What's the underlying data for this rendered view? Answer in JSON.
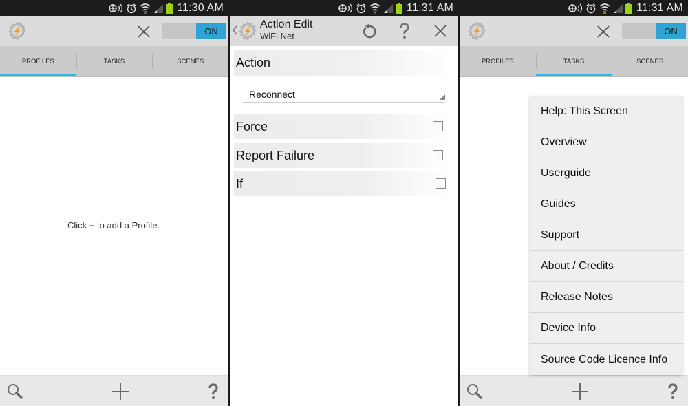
{
  "colors": {
    "accent": "#33b5e5",
    "toggle_on": "#2fa3d6",
    "actionbar": "#dcdcdc",
    "tabbar": "#cbcbcb",
    "battery": "#9bd216"
  },
  "panels": [
    {
      "status": {
        "time": "11:30 AM",
        "icons": [
          "nfc-icon",
          "alarm-icon",
          "wifi-icon",
          "signal-icon",
          "battery-icon"
        ]
      },
      "actionbar": {
        "logo": "tasker-logo",
        "close_icon": "close-icon",
        "toggle_label": "ON"
      },
      "tabs": [
        {
          "label": "PROFILES",
          "active": true
        },
        {
          "label": "TASKS",
          "active": false
        },
        {
          "label": "SCENES",
          "active": false
        }
      ],
      "empty_message": "Click + to add a Profile.",
      "bottombar": {
        "left": "search-icon",
        "center": "plus-icon",
        "right": "help-icon"
      }
    },
    {
      "status": {
        "time": "11:31 AM",
        "icons": [
          "nfc-icon",
          "alarm-icon",
          "wifi-icon",
          "signal-icon",
          "battery-icon"
        ]
      },
      "actionbar": {
        "title": "Action Edit",
        "subtitle": "WiFi Net",
        "icons": [
          "back-icon",
          "revert-icon",
          "help-icon",
          "close-icon"
        ]
      },
      "section_title": "Action",
      "spinner_value": "Reconnect",
      "options": [
        {
          "label": "Force",
          "checked": false
        },
        {
          "label": "Report Failure",
          "checked": false
        },
        {
          "label": "If",
          "checked": false
        }
      ]
    },
    {
      "status": {
        "time": "11:31 AM",
        "icons": [
          "nfc-icon",
          "alarm-icon",
          "wifi-icon",
          "signal-icon",
          "battery-icon"
        ]
      },
      "actionbar": {
        "logo": "tasker-logo",
        "close_icon": "close-icon",
        "toggle_label": "ON"
      },
      "tabs": [
        {
          "label": "PROFILES",
          "active": false
        },
        {
          "label": "TASKS",
          "active": true
        },
        {
          "label": "SCENES",
          "active": false
        }
      ],
      "menu": [
        "Help: This Screen",
        "Overview",
        "Userguide",
        "Guides",
        "Support",
        "About / Credits",
        "Release Notes",
        "Device Info",
        "Source Code Licence Info"
      ],
      "bottombar": {
        "left": "search-icon",
        "center": "plus-icon",
        "right": "help-icon"
      }
    }
  ]
}
